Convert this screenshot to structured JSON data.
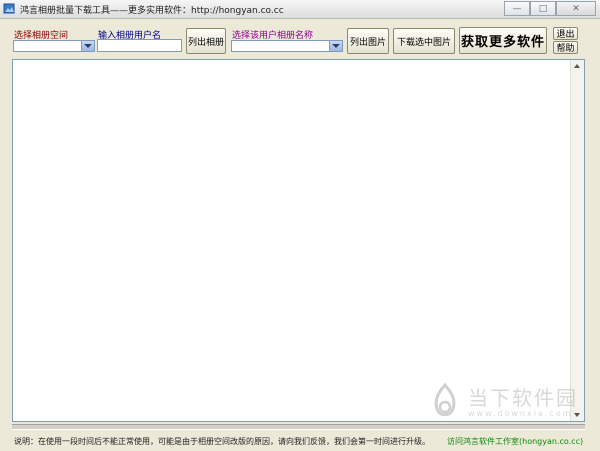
{
  "window": {
    "title": "鸿言相册批量下载工具——更多实用软件：http://hongyan.co.cc",
    "minimize_glyph": "—",
    "restore_glyph": "□",
    "close_glyph": "✕"
  },
  "controls": {
    "album_space_label": "选择相册空间",
    "username_label": "输入相册用户名",
    "user_album_label": "选择该用户相册名称",
    "list_albums_button": "列出相册",
    "list_images_button": "列出图片",
    "download_selected_button": "下载选中图片",
    "more_software_button": "获取更多软件",
    "exit_button": "退出",
    "help_button": "帮助",
    "username_value": ""
  },
  "status": {
    "note": "说明：在使用一段时间后不能正常使用，可能是由于相册空间改版的原因，请向我们反馈，我们会第一时间进行升级。",
    "link": "访问鸿言软件工作室(hongyan.co.cc)"
  },
  "watermark": {
    "name": "当下软件园",
    "url": "www.downxia.com"
  },
  "colors": {
    "album_space_label": "#8b0000",
    "username_label": "#00008b",
    "user_album_label": "#8b008b",
    "status_link": "#0a8a0a"
  }
}
